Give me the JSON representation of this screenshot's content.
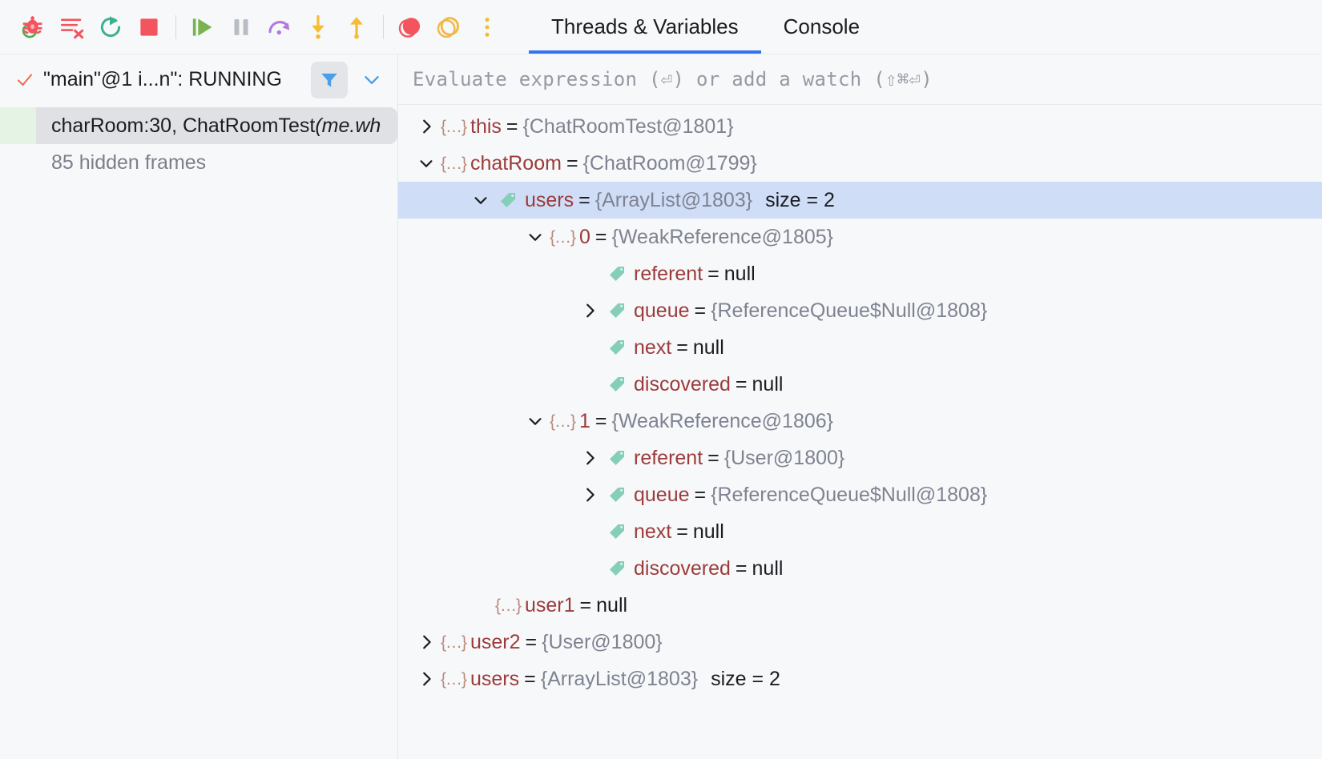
{
  "toolbar": {
    "buttons": [
      {
        "name": "debug-icon",
        "tooltip": "Debug"
      },
      {
        "name": "clear-output-icon",
        "tooltip": "Clear All"
      },
      {
        "name": "rerun-icon",
        "tooltip": "Rerun"
      },
      {
        "name": "stop-icon",
        "tooltip": "Stop"
      },
      {
        "name": "resume-program-icon",
        "tooltip": "Resume Program"
      },
      {
        "name": "pause-program-icon",
        "tooltip": "Pause Program"
      },
      {
        "name": "step-over-icon",
        "tooltip": "Step Over"
      },
      {
        "name": "step-into-icon",
        "tooltip": "Step Into"
      },
      {
        "name": "step-out-icon",
        "tooltip": "Step Out"
      },
      {
        "name": "mute-breakpoints-icon",
        "tooltip": "Mute Breakpoints"
      },
      {
        "name": "view-breakpoints-icon",
        "tooltip": "View Breakpoints"
      },
      {
        "name": "more-options-icon",
        "tooltip": "More"
      }
    ]
  },
  "tabs": [
    {
      "label": "Threads & Variables",
      "active": true
    },
    {
      "label": "Console",
      "active": false
    }
  ],
  "threads_panel": {
    "thread_label": "\"main\"@1 i...n\": RUNNING",
    "check_icon": "check-icon",
    "filter_icon": "filter-icon",
    "chevron_icon": "chevron-down-icon",
    "frames": [
      {
        "text": "charRoom:30, ChatRoomTest ",
        "package": "(me.wh",
        "selected": true
      }
    ],
    "hidden_frames_label": "85 hidden frames"
  },
  "evaluate_bar": {
    "placeholder": "Evaluate expression (⏎) or add a watch (⇧⌘⏎)"
  },
  "variables": [
    {
      "indent": 0,
      "twisty": "collapsed",
      "icon": "braces",
      "name": "this",
      "value": "{ChatRoomTest@1801}",
      "value_type": "obj",
      "size": "",
      "selected": false
    },
    {
      "indent": 0,
      "twisty": "expanded",
      "icon": "braces",
      "name": "chatRoom",
      "value": "{ChatRoom@1799}",
      "value_type": "obj",
      "size": "",
      "selected": false
    },
    {
      "indent": 1,
      "twisty": "expanded",
      "icon": "tag",
      "name": "users",
      "value": "{ArrayList@1803}",
      "value_type": "obj",
      "size": "size = 2",
      "selected": true
    },
    {
      "indent": 2,
      "twisty": "expanded",
      "icon": "braces",
      "name": "0",
      "value": "{WeakReference@1805}",
      "value_type": "obj",
      "size": "",
      "selected": false
    },
    {
      "indent": 3,
      "twisty": "none",
      "icon": "tag",
      "name": "referent",
      "value": "null",
      "value_type": "null",
      "size": "",
      "selected": false
    },
    {
      "indent": 3,
      "twisty": "collapsed",
      "icon": "tag",
      "name": "queue",
      "value": "{ReferenceQueue$Null@1808}",
      "value_type": "obj",
      "size": "",
      "selected": false
    },
    {
      "indent": 3,
      "twisty": "none",
      "icon": "tag",
      "name": "next",
      "value": "null",
      "value_type": "null",
      "size": "",
      "selected": false
    },
    {
      "indent": 3,
      "twisty": "none",
      "icon": "tag",
      "name": "discovered",
      "value": "null",
      "value_type": "null",
      "size": "",
      "selected": false
    },
    {
      "indent": 2,
      "twisty": "expanded",
      "icon": "braces",
      "name": "1",
      "value": "{WeakReference@1806}",
      "value_type": "obj",
      "size": "",
      "selected": false
    },
    {
      "indent": 3,
      "twisty": "collapsed",
      "icon": "tag",
      "name": "referent",
      "value": "{User@1800}",
      "value_type": "obj",
      "size": "",
      "selected": false
    },
    {
      "indent": 3,
      "twisty": "collapsed",
      "icon": "tag",
      "name": "queue",
      "value": "{ReferenceQueue$Null@1808}",
      "value_type": "obj",
      "size": "",
      "selected": false
    },
    {
      "indent": 3,
      "twisty": "none",
      "icon": "tag",
      "name": "next",
      "value": "null",
      "value_type": "null",
      "size": "",
      "selected": false
    },
    {
      "indent": 3,
      "twisty": "none",
      "icon": "tag",
      "name": "discovered",
      "value": "null",
      "value_type": "null",
      "size": "",
      "selected": false
    },
    {
      "indent": 1,
      "twisty": "none",
      "icon": "braces",
      "name": "user1",
      "value": "null",
      "value_type": "null",
      "size": "",
      "selected": false
    },
    {
      "indent": 0,
      "twisty": "collapsed",
      "icon": "braces",
      "name": "user2",
      "value": "{User@1800}",
      "value_type": "obj",
      "size": "",
      "selected": false
    },
    {
      "indent": 0,
      "twisty": "collapsed",
      "icon": "braces",
      "name": "users",
      "value": "{ArrayList@1803}",
      "value_type": "obj",
      "size": "size = 2",
      "selected": false
    }
  ],
  "colors": {
    "accent_blue": "#3574f0",
    "selection_blue": "#cfddf7",
    "var_name_red": "#9c3b3b",
    "var_value_gray": "#7f8391",
    "braces_brown": "#b9897a",
    "tag_teal": "#85cfb8",
    "filter_blue": "#4a9fe8",
    "stop_red": "#f2555e",
    "resume_green": "#62b543",
    "step_yellow": "#f5bd35",
    "step_over_purple": "#b07ae0",
    "background": "#f7f8fa"
  }
}
